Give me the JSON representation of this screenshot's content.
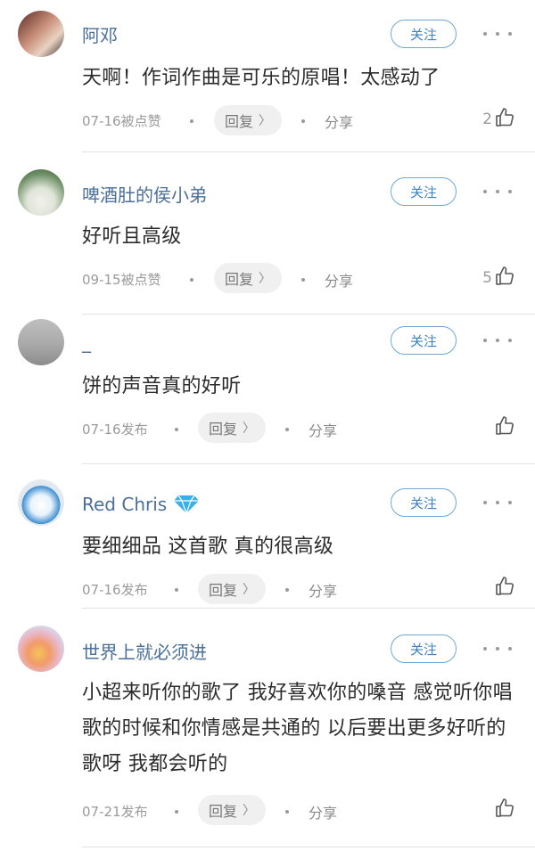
{
  "labels": {
    "follow": "关注",
    "reply": "回复",
    "share": "分享"
  },
  "comments": [
    {
      "user": "阿邓",
      "text": "天啊！作词作曲是可乐的原唱！太感动了",
      "meta": "07-16被点赞",
      "likes": "2"
    },
    {
      "user": "啤酒肚的侯小弟",
      "text": "好听且高级",
      "meta": "09-15被点赞",
      "likes": "5"
    },
    {
      "user": "_",
      "text": "饼的声音真的好听",
      "meta": "07-16发布",
      "likes": ""
    },
    {
      "user": "Red Chris",
      "badge": "diamond-icon",
      "text": "要细细品 这首歌 真的很高级",
      "meta": "07-16发布",
      "likes": ""
    },
    {
      "user": "世界上就必须进",
      "text": "小超来听你的歌了 我好喜欢你的嗓音 感觉听你唱歌的时候和你情感是共通的 以后要出更多好听的歌呀 我都会听的",
      "meta": "07-21发布",
      "likes": ""
    }
  ],
  "colors": {
    "username": "#4a6f99",
    "follow_border": "#6fa8d6",
    "follow_text": "#3c82c2",
    "badge": "#3bb0e6"
  },
  "icons": {
    "like": "thumbs-up-icon",
    "more": "more-dots-icon",
    "reply_chevron": "chevron-right-icon"
  }
}
